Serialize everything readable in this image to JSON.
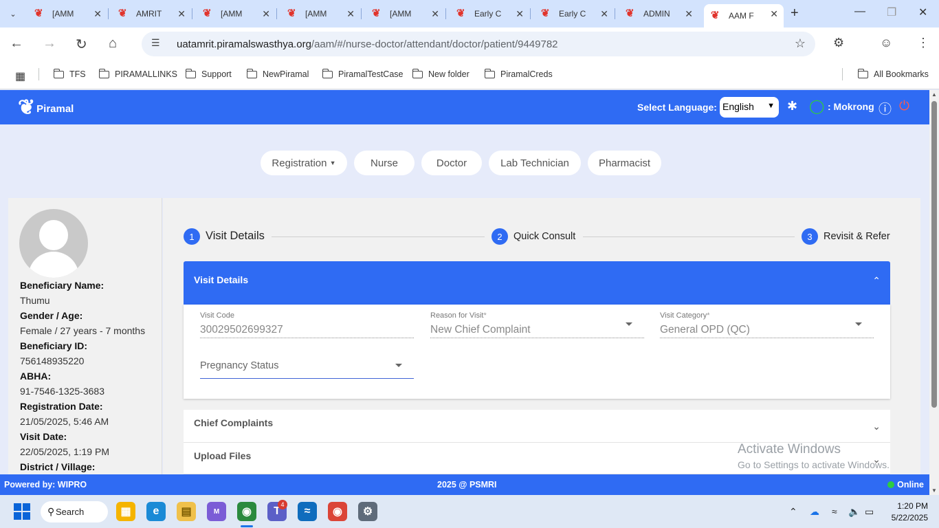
{
  "browser": {
    "tabs": [
      {
        "label": "[AMM",
        "active": false
      },
      {
        "label": "AMRIT",
        "active": false
      },
      {
        "label": "[AMM",
        "active": false
      },
      {
        "label": "[AMM",
        "active": false
      },
      {
        "label": "[AMM",
        "active": false
      },
      {
        "label": "Early C",
        "active": false
      },
      {
        "label": "Early C",
        "active": false
      },
      {
        "label": "ADMIN",
        "active": false
      },
      {
        "label": "AAM F",
        "active": true
      }
    ],
    "url_host": "uatamrit.piramalswasthya.org",
    "url_path": "/aam/#/nurse-doctor/attendant/doctor/patient/9449782",
    "bookmarks": [
      "TFS",
      "PIRAMALLINKS",
      "Support",
      "NewPiramal",
      "PiramalTestCase",
      "New folder",
      "PiramalCreds"
    ],
    "all_bookmarks": "All Bookmarks"
  },
  "header": {
    "brand": "Piramal",
    "select_language_label": "Select Language:",
    "language": "English",
    "user_name": ": Mokrong"
  },
  "roles": [
    "Registration",
    "Nurse",
    "Doctor",
    "Lab Technician",
    "Pharmacist"
  ],
  "patient": {
    "name_label": "Beneficiary Name:",
    "name": "Thumu",
    "gender_age_label": "Gender / Age:",
    "gender_age": "Female / 27 years - 7 months",
    "id_label": "Beneficiary ID:",
    "id": "756148935220",
    "abha_label": "ABHA:",
    "abha": "91-7546-1325-3683",
    "reg_date_label": "Registration Date:",
    "reg_date": "21/05/2025, 5:46 AM",
    "visit_date_label": "Visit Date:",
    "visit_date": "22/05/2025, 1:19 PM",
    "district_label": "District / Village:"
  },
  "stepper": [
    {
      "num": "1",
      "label": "Visit Details"
    },
    {
      "num": "2",
      "label": "Quick Consult"
    },
    {
      "num": "3",
      "label": "Revisit & Refer"
    }
  ],
  "visit_details": {
    "title": "Visit Details",
    "visit_code_label": "Visit Code",
    "visit_code": "30029502699327",
    "reason_label": "Reason for Visit",
    "reason": "New Chief Complaint",
    "category_label": "Visit Category",
    "category": "General OPD (QC)",
    "pregnancy_placeholder": "Pregnancy Status",
    "required_mark": "*"
  },
  "accordions": [
    "Chief Complaints",
    "Upload Files"
  ],
  "watermark": {
    "line1": "Activate Windows",
    "line2": "Go to Settings to activate Windows."
  },
  "footer": {
    "powered_by": "Powered by: WIPRO",
    "copyright": "2025 @ PSMRI",
    "status": "Online"
  },
  "taskbar": {
    "search": "Search",
    "teams_badge": "4",
    "time": "1:20 PM",
    "date": "5/22/2025"
  },
  "colors": {
    "primary": "#2f6bf3",
    "online": "#2ecc40"
  }
}
